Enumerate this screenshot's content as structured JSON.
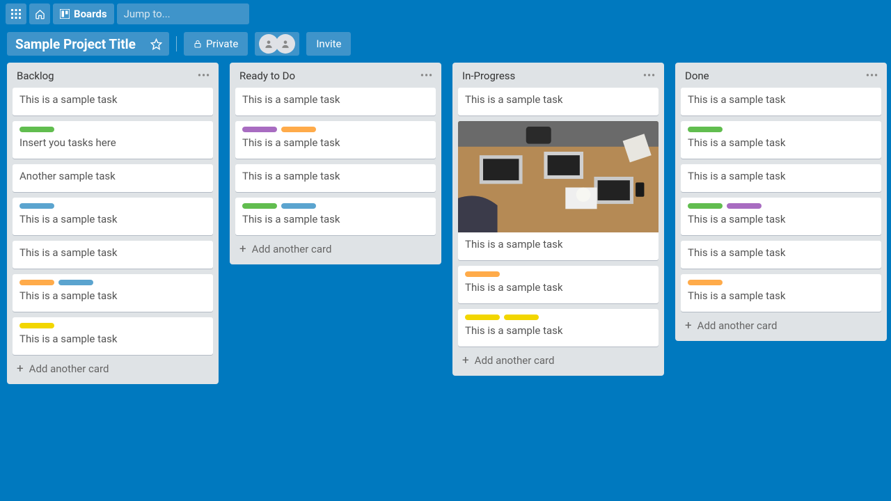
{
  "nav": {
    "boards_label": "Boards",
    "search_placeholder": "Jump to..."
  },
  "header": {
    "board_title": "Sample Project Title",
    "privacy_label": "Private",
    "invite_label": "Invite"
  },
  "lists": [
    {
      "title": "Backlog",
      "cards": [
        {
          "labels": [],
          "text": "This is a sample task"
        },
        {
          "labels": [
            "green"
          ],
          "text": "Insert you tasks here"
        },
        {
          "labels": [],
          "text": "Another sample task"
        },
        {
          "labels": [
            "blue"
          ],
          "text": "This is a sample task"
        },
        {
          "labels": [],
          "text": "This is a sample task"
        },
        {
          "labels": [
            "orange",
            "blue"
          ],
          "text": "This is a sample task"
        },
        {
          "labels": [
            "yellow"
          ],
          "text": "This is a sample task"
        }
      ]
    },
    {
      "title": "Ready to Do",
      "cards": [
        {
          "labels": [],
          "text": "This is a sample task"
        },
        {
          "labels": [
            "purple",
            "orange"
          ],
          "text": "This is a sample task"
        },
        {
          "labels": [],
          "text": "This is a sample task"
        },
        {
          "labels": [
            "green",
            "blue"
          ],
          "text": "This is a sample task"
        }
      ]
    },
    {
      "title": "In-Progress",
      "cards": [
        {
          "labels": [],
          "text": "This is a sample task"
        },
        {
          "labels": [],
          "text": "This is a sample task",
          "image": true
        },
        {
          "labels": [
            "orange"
          ],
          "text": "This is a sample task"
        },
        {
          "labels": [
            "yellow",
            "yellow"
          ],
          "text": "This is a sample task"
        }
      ]
    },
    {
      "title": "Done",
      "cards": [
        {
          "labels": [],
          "text": "This is a sample task"
        },
        {
          "labels": [
            "green"
          ],
          "text": "This is a sample task"
        },
        {
          "labels": [],
          "text": "This is a sample task"
        },
        {
          "labels": [
            "green",
            "purple"
          ],
          "text": "This is a sample task"
        },
        {
          "labels": [],
          "text": "This is a sample task"
        },
        {
          "labels": [
            "orange"
          ],
          "text": "This is a sample task"
        }
      ]
    }
  ],
  "add_card_label": "Add another card"
}
